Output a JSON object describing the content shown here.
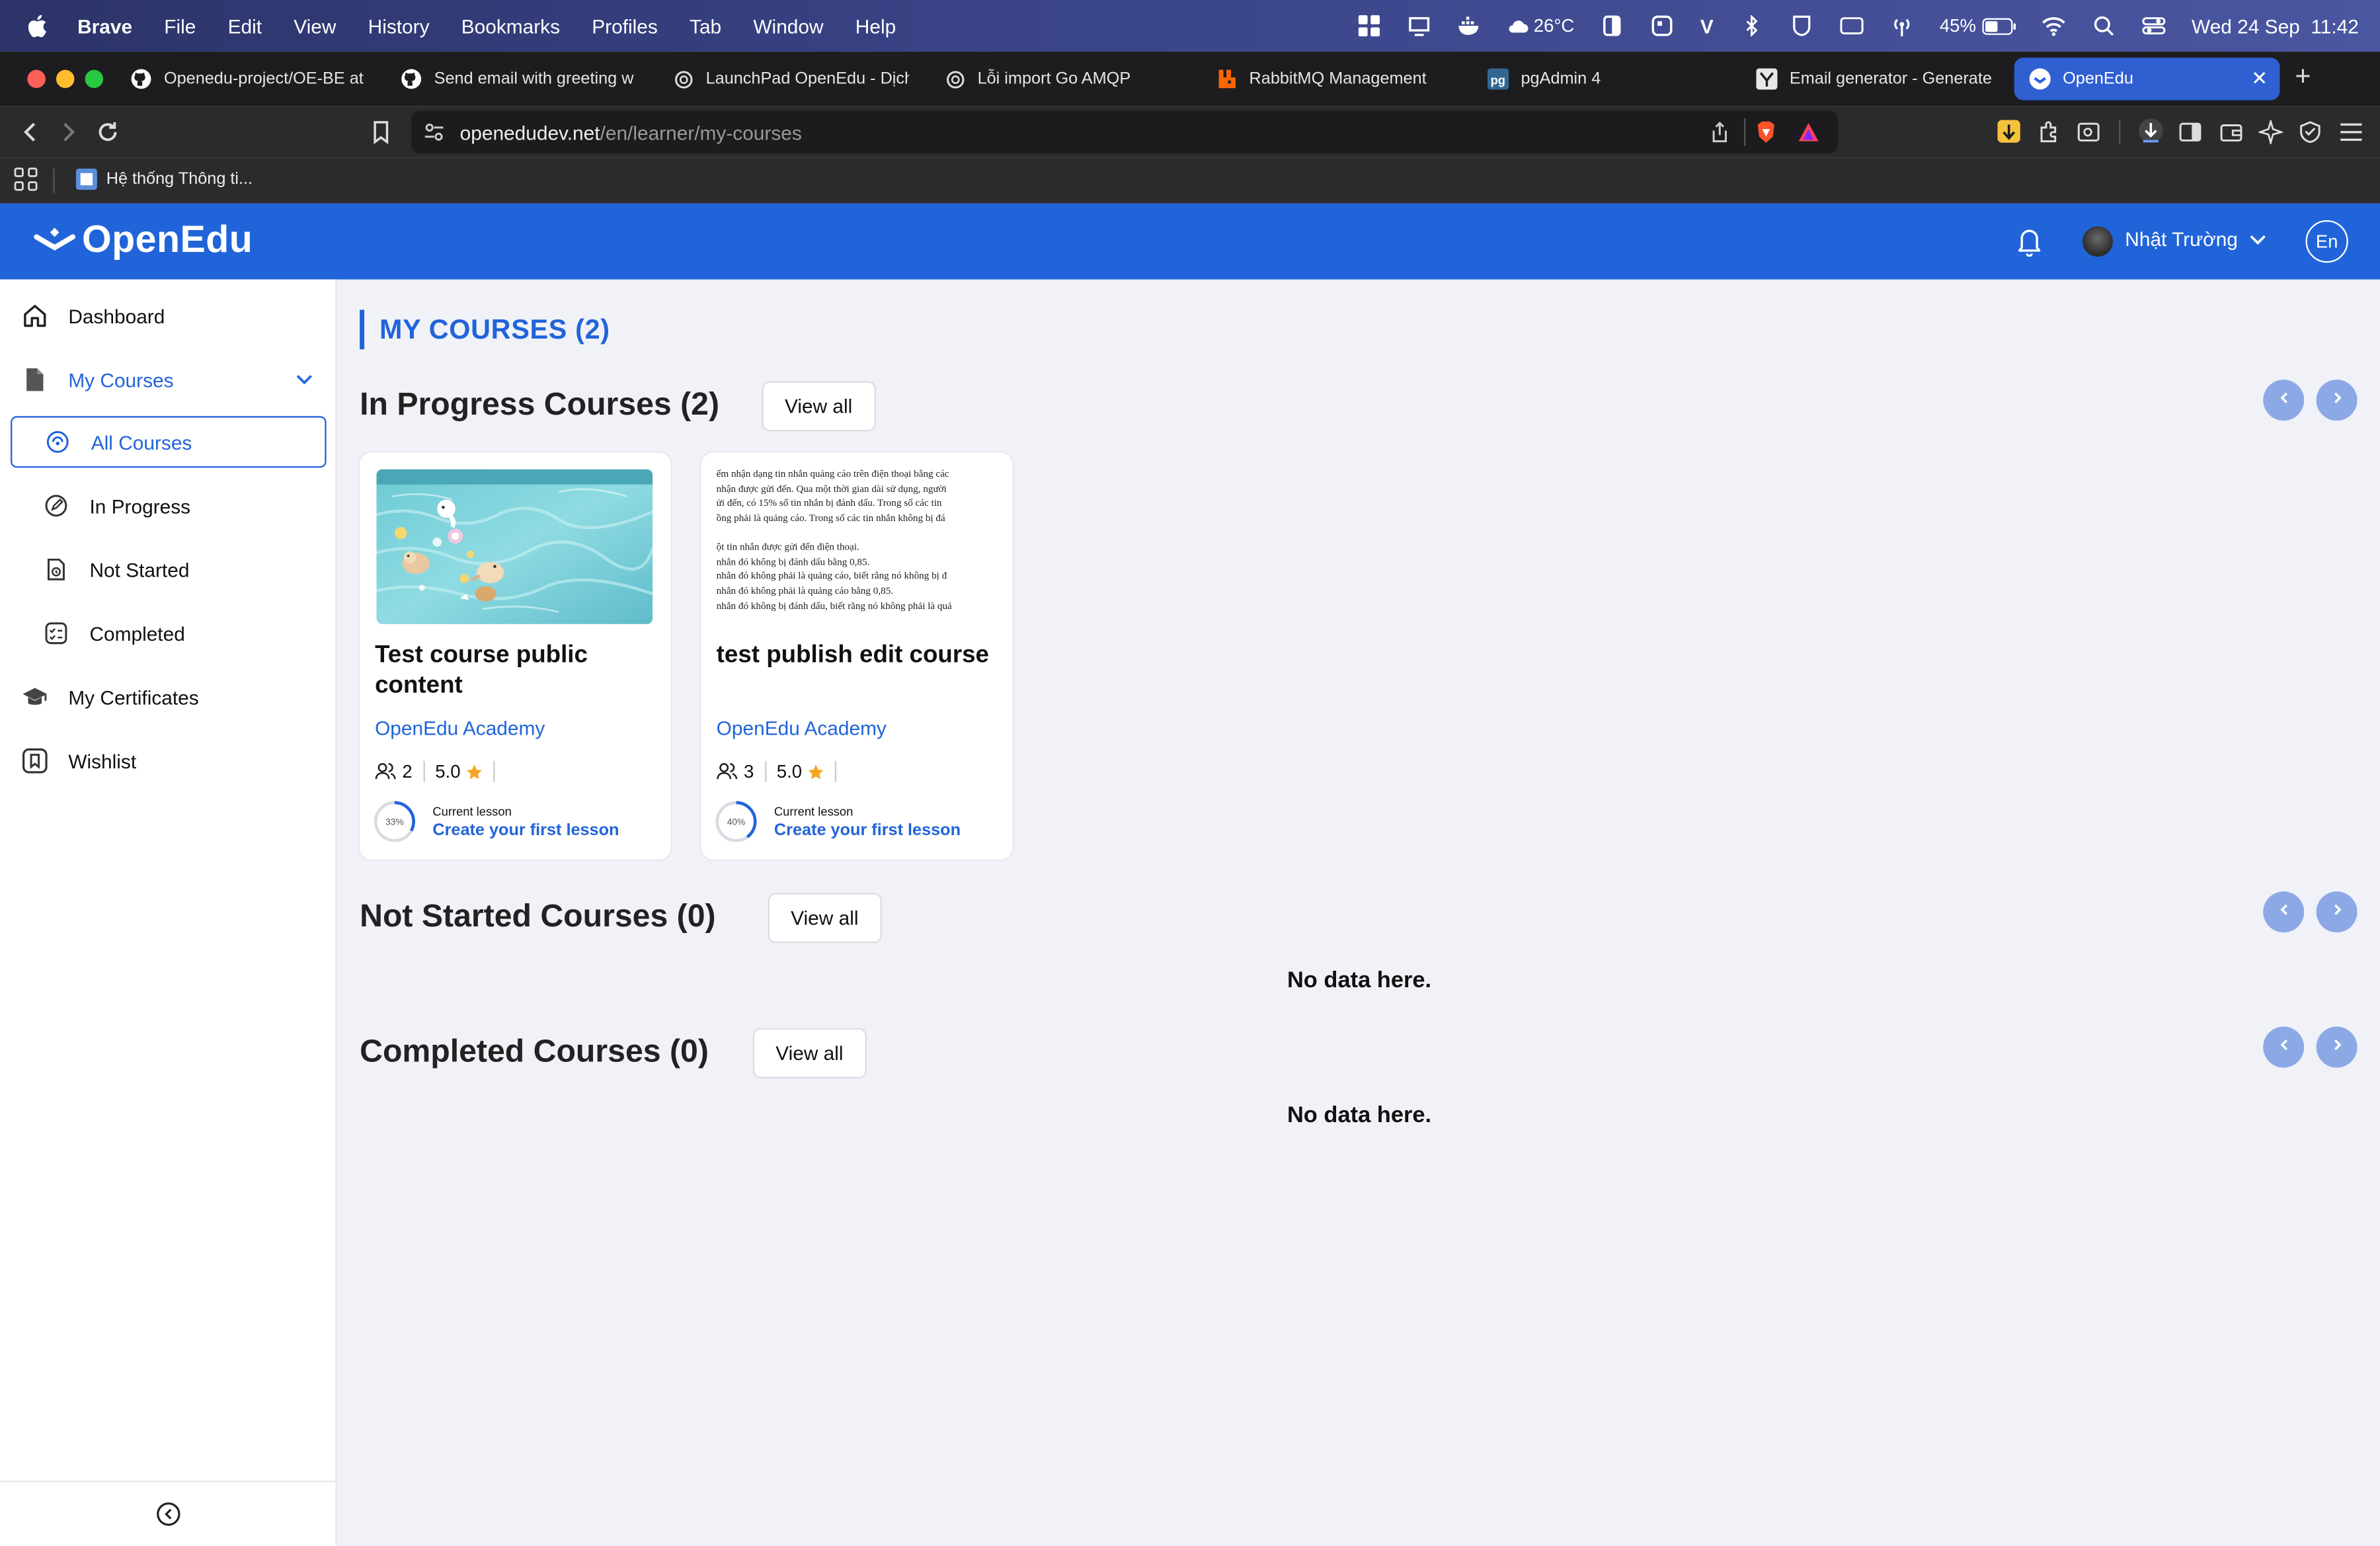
{
  "menubar": {
    "app": "Brave",
    "items": [
      "File",
      "Edit",
      "View",
      "History",
      "Bookmarks",
      "Profiles",
      "Tab",
      "Window",
      "Help"
    ],
    "weather": "26°C",
    "battery": "45%",
    "datetime": "Wed 24 Sep  11:42"
  },
  "tabs": [
    {
      "title": "Openedu-project/OE-BE at",
      "icon": "github-icon"
    },
    {
      "title": "Send email with greeting w",
      "icon": "github-icon"
    },
    {
      "title": "LaunchPad OpenEdu - Dịch",
      "icon": "openai-icon"
    },
    {
      "title": "Lỗi import Go AMQP",
      "icon": "openai-icon"
    },
    {
      "title": "RabbitMQ Management",
      "icon": "rabbitmq-icon"
    },
    {
      "title": "pgAdmin 4",
      "icon": "pgadmin-icon"
    },
    {
      "title": "Email generator - Generate",
      "icon": "yc-icon"
    },
    {
      "title": "OpenEdu",
      "icon": "openedu-icon"
    }
  ],
  "address": {
    "host": "openedudev.net",
    "path": "/en/learner/my-courses"
  },
  "bookmark": "Hệ thống Thông ti...",
  "header": {
    "brand": "OpenEdu",
    "user_name": "Nhật Trường",
    "lang": "En"
  },
  "sidebar": {
    "dashboard": "Dashboard",
    "my_courses": "My Courses",
    "sub": [
      "All Courses",
      "In Progress",
      "Not Started",
      "Completed"
    ],
    "certificates": "My Certificates",
    "wishlist": "Wishlist"
  },
  "main": {
    "title": "MY COURSES (2)",
    "in_progress_title": "In Progress Courses (2)",
    "not_started_title": "Not Started Courses (0)",
    "completed_title": "Completed Courses (0)",
    "view_all": "View all",
    "no_data": "No data here.",
    "current_lesson_label": "Current lesson"
  },
  "courses": [
    {
      "title": "Test course public content",
      "org": "OpenEdu Academy",
      "learners": "2",
      "rating": "5.0",
      "progress_label": "33%",
      "progress": 0.33,
      "current_lesson": "Create your first lesson"
    },
    {
      "title": "test publish edit course",
      "org": "OpenEdu Academy",
      "learners": "3",
      "rating": "5.0",
      "progress_label": "40%",
      "progress": 0.4,
      "current_lesson": "Create your first lesson",
      "thumb_lines": [
        "ểm nhận dạng tin nhắn quảng cáo trên điện thoại bằng các",
        "nhận được gửi đến. Qua một thời gian dài sử dụng, người",
        "ửi đến, có 15% số tin nhắn bị đánh dấu. Trong số các tin",
        "ồng phải là quảng cáo. Trong số các tin nhắn không bị đá",
        "ột tin nhắn được gửi đến điện thoại.",
        "nhắn đó không bị đánh dấu bằng 0,85.",
        "nhắn đó không phải là quảng cáo, biết rằng nó không bị đ",
        "nhắn đó không phải là quảng cáo bằng 0,85.",
        "nhắn đó không bị đánh dấu, biết rằng nó không phải là quả"
      ]
    }
  ],
  "colors": {
    "brand": "#2164d9",
    "star": "#f5a623"
  }
}
